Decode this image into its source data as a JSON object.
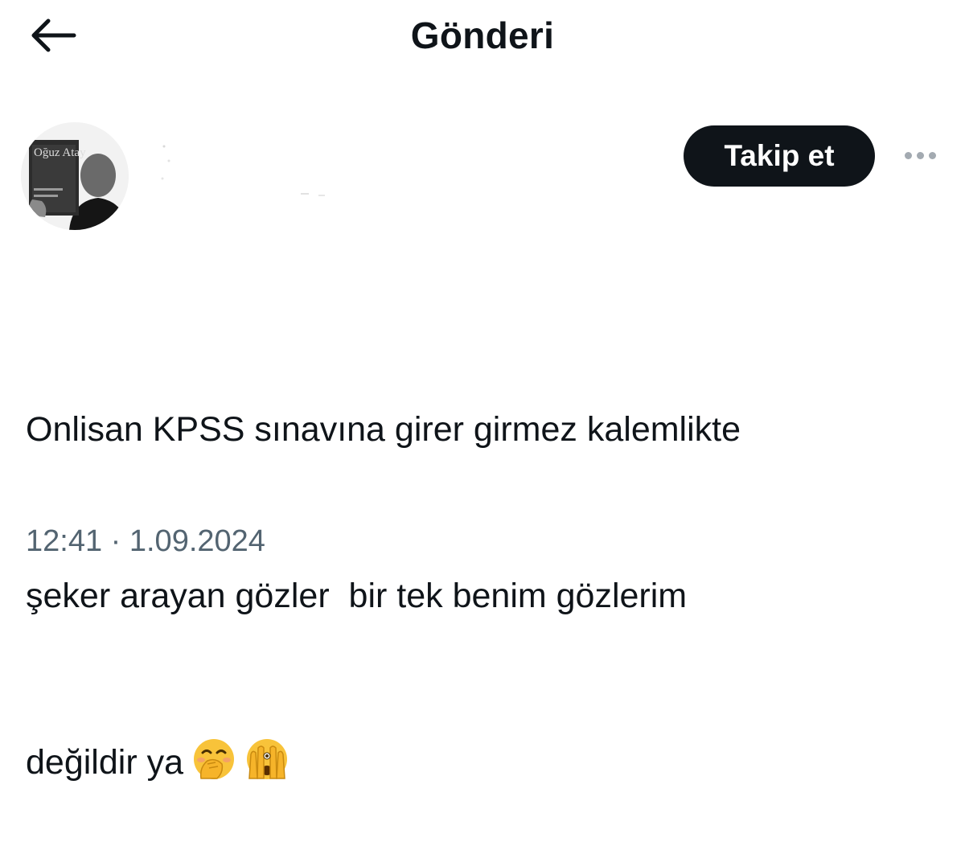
{
  "header": {
    "title": "Gönderi"
  },
  "author": {
    "avatar_book_title": "Oğuz Atay"
  },
  "follow_label": "Takip et",
  "tweet": {
    "lines": [
      "Onlisan KPSS sınavına girer girmez kalemlikte",
      "şeker arayan gözler  bir tek benim gözlerim",
      "değildir ya"
    ],
    "emojis": [
      "face-with-hand-over-mouth",
      "face-with-peeking-eye"
    ]
  },
  "timestamp": "12:41 · 1.09.2024",
  "colors": {
    "text": "#0f1419",
    "secondary": "#536471",
    "follow_button_bg": "#0f1419",
    "more_dots": "#a3aab1",
    "emoji_yellow": "#f8c33a"
  }
}
